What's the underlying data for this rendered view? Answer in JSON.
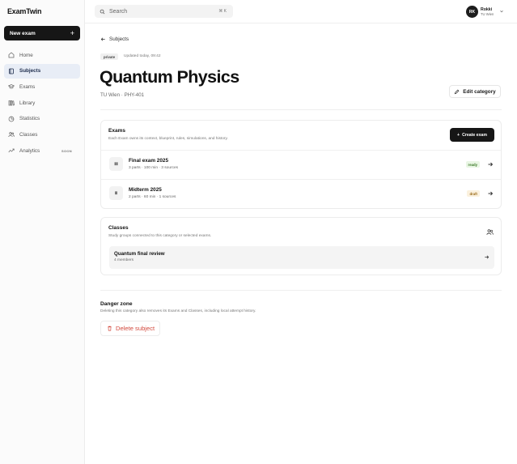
{
  "app": {
    "logo": "ExamTwin",
    "new_exam_label": "New exam"
  },
  "sidebar": {
    "items": [
      {
        "label": "Home",
        "icon": "home-icon"
      },
      {
        "label": "Subjects",
        "icon": "book-icon",
        "active": true
      },
      {
        "label": "Exams",
        "icon": "graduation-cap-icon"
      },
      {
        "label": "Library",
        "icon": "library-icon"
      },
      {
        "label": "Statistics",
        "icon": "stats-icon"
      },
      {
        "label": "Classes",
        "icon": "users-icon"
      },
      {
        "label": "Analytics",
        "icon": "analytics-icon",
        "tag": "SOON"
      }
    ]
  },
  "topbar": {
    "search_placeholder": "Search",
    "search_shortcut": "⌘ K",
    "user": {
      "initials": "RK",
      "name": "Rokki",
      "org": "TU Wien"
    }
  },
  "page": {
    "back_label": "Subjects",
    "visibility": "private",
    "updated": "Updated today, 09:42",
    "title": "Quantum Physics",
    "subtitle": "TU Wien · PHY-401",
    "edit_label": "Edit category"
  },
  "exams": {
    "title": "Exams",
    "description": "Each Exam owns its context, blueprint, rules, simulations, and history.",
    "create_label": "Create exam",
    "rows": [
      {
        "icon_text": "ⅡⅡ",
        "title": "Final exam 2025",
        "meta": "3 parts · 100 min · 3 sources",
        "status": "ready",
        "status_bg": "#e9f6e4",
        "status_fg": "#3d7a2a"
      },
      {
        "icon_text": "ⅡⅠ",
        "title": "Midterm 2025",
        "meta": "2 parts · 60 min · 1 sources",
        "status": "draft",
        "status_bg": "#fbf1de",
        "status_fg": "#9a6a18"
      }
    ]
  },
  "classes": {
    "title": "Classes",
    "description": "Study groups connected to this category or selected exams.",
    "rows": [
      {
        "title": "Quantum final review",
        "members": "4 members"
      }
    ]
  },
  "danger": {
    "title": "Danger zone",
    "description": "Deleting this category also removes its Exams and Classes, including local attempt history.",
    "delete_label": "Delete subject",
    "color": "#d2483c"
  }
}
